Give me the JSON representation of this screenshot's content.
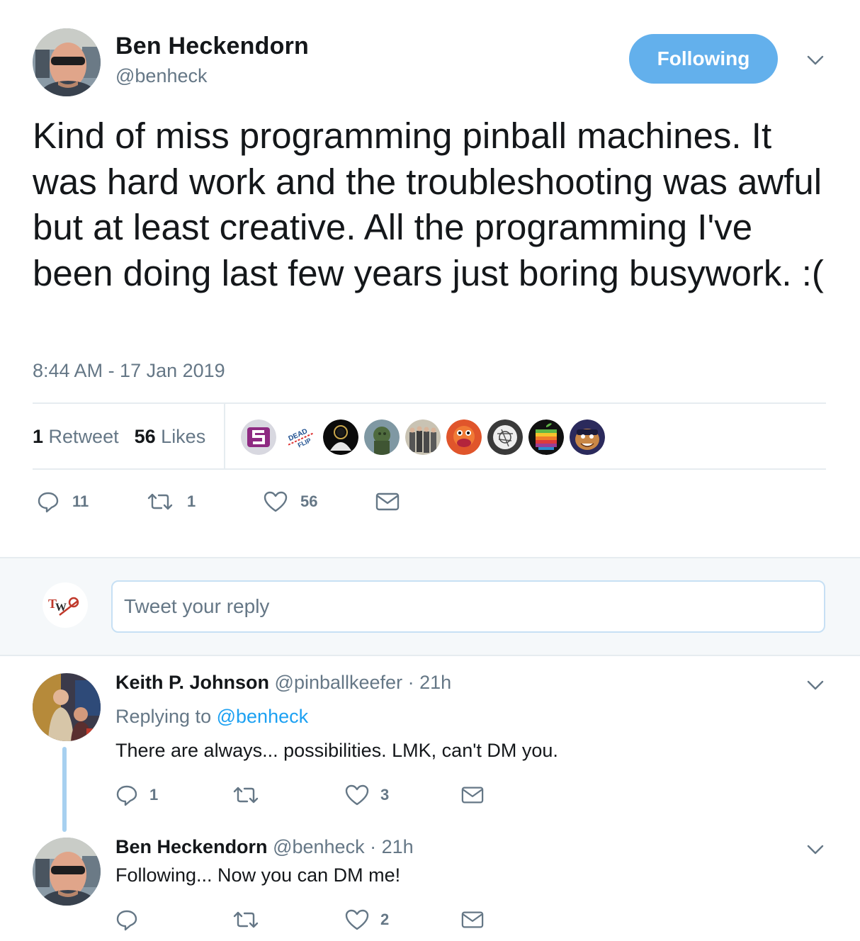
{
  "tweet": {
    "author_name": "Ben Heckendorn",
    "author_handle": "@benheck",
    "follow_button": "Following",
    "text": "Kind of miss programming pinball machines. It was hard work and the troubleshooting was awful but at least creative. All the programming I've been doing last few years just boring busywork. :(",
    "timestamp": "8:44 AM - 17 Jan 2019",
    "stats": {
      "retweets_count": "1",
      "retweets_label": "Retweet",
      "likes_count": "56",
      "likes_label": "Likes"
    },
    "actions": {
      "replies": "11",
      "retweets": "1",
      "likes": "56"
    },
    "liker_icons": [
      "s-logo-avatar",
      "dead-flip-avatar",
      "silhouette-avatar",
      "statue-avatar",
      "group-photo-avatar",
      "muppet-avatar",
      "sketch-avatar",
      "rainbow-apple-avatar",
      "cartoon-face-avatar"
    ]
  },
  "reply_box": {
    "placeholder": "Tweet your reply"
  },
  "replies": [
    {
      "name": "Keith P. Johnson",
      "handle": "@pinballkeefer",
      "time": "· 21h",
      "replying_prefix": "Replying to",
      "replying_to": "@benheck",
      "text": "There are always... possibilities. LMK, can't DM you.",
      "actions": {
        "replies": "1",
        "retweets": "",
        "likes": "3"
      }
    },
    {
      "name": "Ben Heckendorn",
      "handle": "@benheck",
      "time": "· 21h",
      "text": "Following... Now you can DM me!",
      "actions": {
        "replies": "",
        "retweets": "",
        "likes": "2"
      }
    }
  ],
  "colors": {
    "accent": "#1da1f2",
    "follow_bg": "#63b0ec",
    "muted": "#657786",
    "text": "#14171a"
  }
}
